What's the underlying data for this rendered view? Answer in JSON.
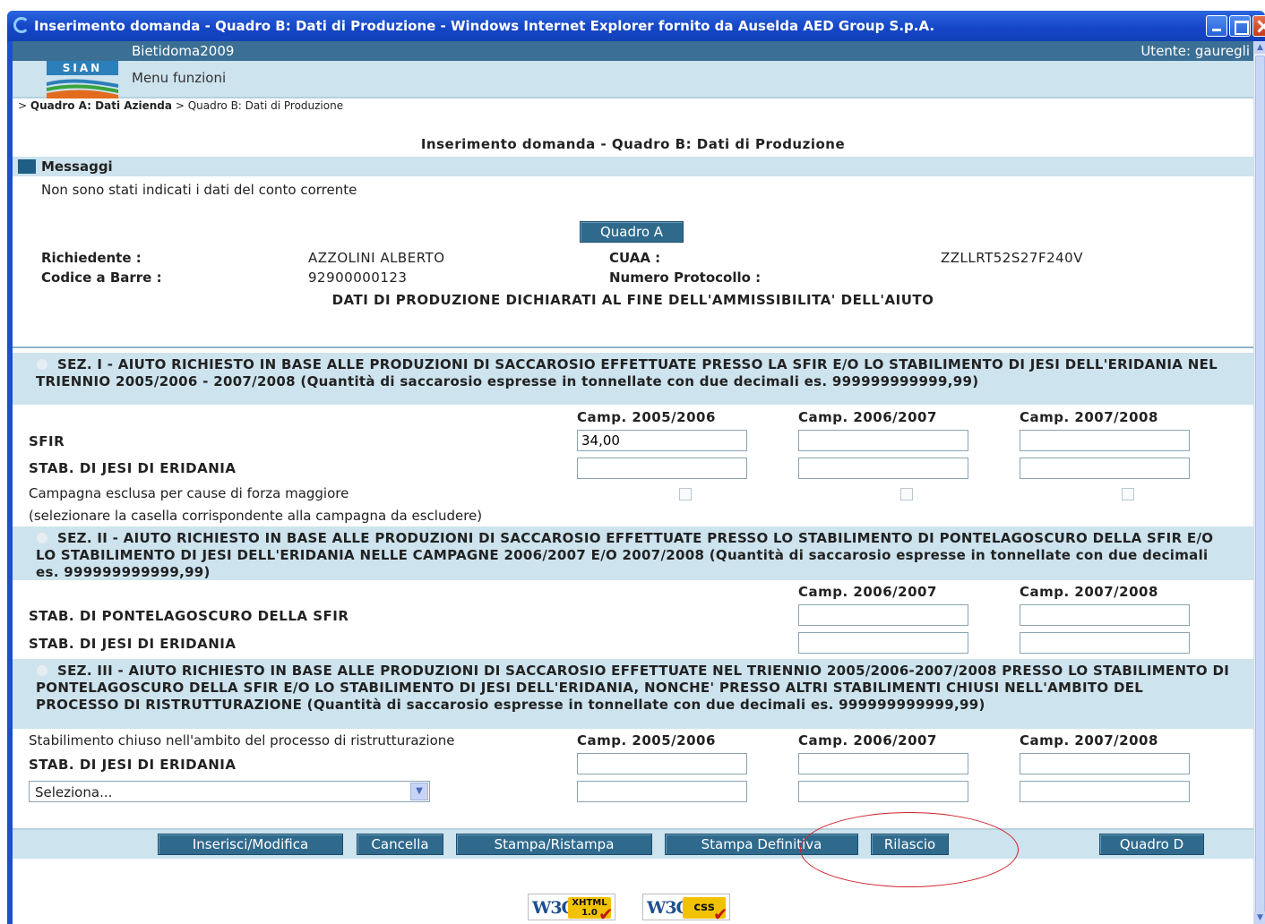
{
  "window": {
    "title": "Inserimento domanda - Quadro B: Dati di Produzione - Windows Internet Explorer fornito da Auselda AED Group S.p.A."
  },
  "header": {
    "app_name": "Bietidoma2009",
    "user": "Utente: gauregli",
    "logo_text": "SIAN",
    "menu": "Menu funzioni"
  },
  "breadcrumb": {
    "prefix": ">",
    "item1": "Quadro A: Dati Azienda",
    "sep": ">",
    "item2": "Quadro B: Dati di Produzione"
  },
  "page": {
    "title": "Inserimento domanda - Quadro B: Dati di Produzione",
    "messages_label": "Messaggi",
    "message": "Non sono stati indicati i dati del conto corrente",
    "quadro_a_button": "Quadro A"
  },
  "applicant": {
    "richiedente_label": "Richiedente :",
    "richiedente_value": "AZZOLINI ALBERTO",
    "cuaa_label": "CUAA :",
    "cuaa_value": "ZZLLRT52S27F240V",
    "codice_label": "Codice a Barre :",
    "codice_value": "92900000123",
    "protocollo_label": "Numero Protocollo :",
    "protocollo_value": ""
  },
  "dati_title": "DATI DI PRODUZIONE DICHIARATI AL FINE DELL'AMMISSIBILITA' DELL'AIUTO",
  "sez1": {
    "title": "SEZ. I - AIUTO RICHIESTO IN BASE ALLE PRODUZIONI DI SACCAROSIO EFFETTUATE PRESSO LA SFIR E/O LO STABILIMENTO DI JESI DELL'ERIDANIA NEL TRIENNIO 2005/2006 - 2007/2008 (Quantità di saccarosio espresse in tonnellate con due decimali es. 999999999999,99)",
    "col1": "Camp. 2005/2006",
    "col2": "Camp. 2006/2007",
    "col3": "Camp. 2007/2008",
    "row1_label": "SFIR",
    "row1_values": [
      "34,00",
      "",
      ""
    ],
    "row2_label": "STAB. DI JESI DI ERIDANIA",
    "row2_values": [
      "",
      "",
      ""
    ],
    "excluded_label": "Campagna esclusa per cause di forza maggiore",
    "excluded_note": "(selezionare la casella corrispondente alla campagna da escludere)",
    "excluded_checked": [
      false,
      false,
      false
    ]
  },
  "sez2": {
    "title": "SEZ. II - AIUTO RICHIESTO IN BASE ALLE PRODUZIONI DI SACCAROSIO EFFETTUATE PRESSO LO STABILIMENTO DI PONTELAGOSCURO DELLA SFIR E/O LO STABILIMENTO DI JESI DELL'ERIDANIA NELLE CAMPAGNE 2006/2007 E/O 2007/2008 (Quantità di saccarosio espresse in tonnellate con due decimali es. 999999999999,99)",
    "col1": "Camp. 2006/2007",
    "col2": "Camp. 2007/2008",
    "row1_label": "STAB. DI PONTELAGOSCURO DELLA SFIR",
    "row2_label": "STAB. DI JESI DI ERIDANIA"
  },
  "sez3": {
    "title": "SEZ. III - AIUTO RICHIESTO IN BASE ALLE PRODUZIONI DI SACCAROSIO EFFETTUATE NEL TRIENNIO 2005/2006-2007/2008 PRESSO LO STABILIMENTO DI PONTELAGOSCURO DELLA SFIR E/O LO STABILIMENTO DI JESI DELL'ERIDANIA, NONCHE' PRESSO ALTRI STABILIMENTI CHIUSI NELL'AMBITO DEL PROCESSO DI RISTRUTTURAZIONE (Quantità di saccarosio espresse in tonnellate con due decimali es. 999999999999,99)",
    "closed_label": "Stabilimento chiuso nell'ambito del processo di ristrutturazione",
    "col1": "Camp. 2005/2006",
    "col2": "Camp. 2006/2007",
    "col3": "Camp. 2007/2008",
    "row1_label": "STAB. DI JESI DI ERIDANIA",
    "select_value": "Seleziona..."
  },
  "buttons": {
    "inserisci": "Inserisci/Modifica",
    "cancella": "Cancella",
    "stampa": "Stampa/Ristampa",
    "stampa_def": "Stampa Definitiva",
    "rilascio": "Rilascio",
    "quadro_d": "Quadro D"
  },
  "badges": {
    "xhtml_logo": "W3C",
    "xhtml_tag1": "XHTML",
    "xhtml_tag2": "1.0",
    "css_logo": "W3C",
    "css_tag": "css"
  },
  "colors": {
    "titlebar": "#1546c6",
    "header_dark": "#3b6f94",
    "header_light": "#cde3ee",
    "button": "#2f6a8d",
    "annotation": "#d0212a"
  }
}
